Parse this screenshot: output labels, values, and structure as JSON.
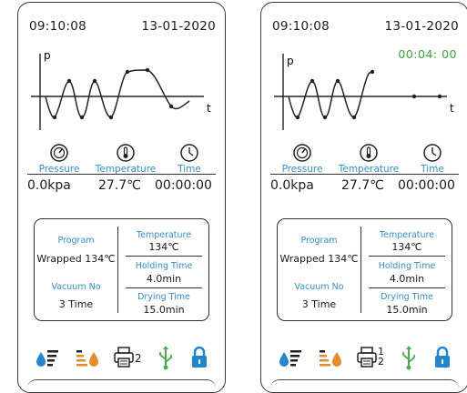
{
  "screens": [
    {
      "header": {
        "time": "09:10:08",
        "date": "13-01-2020"
      },
      "graph": {
        "y_label": "p",
        "x_label": "t"
      },
      "sensors": [
        {
          "label": "Pressure",
          "icon": "pressure-gauge-icon",
          "value": "0.0kpa"
        },
        {
          "label": "Temperature",
          "icon": "thermometer-icon",
          "value": "27.7℃"
        },
        {
          "label": "Time",
          "icon": "clock-icon",
          "value": "00:00:00"
        }
      ],
      "program": {
        "program_label": "Program",
        "program_value": "Wrapped 134℃",
        "vacuum_label": "Vacuum No",
        "vacuum_value": "3 Time",
        "temperature_label": "Temperature",
        "temperature_value": "134℃",
        "holding_label": "Holding Time",
        "holding_value": "4.0min",
        "drying_label": "Drying Time",
        "drying_value": "15.0min"
      },
      "status_icons": {
        "printer_count": "2"
      }
    },
    {
      "header": {
        "time": "09:10:08",
        "date": "13-01-2020",
        "timer": "00:04: 00"
      },
      "graph": {
        "y_label": "p",
        "x_label": "t"
      },
      "sensors": [
        {
          "label": "Pressure",
          "icon": "pressure-gauge-icon",
          "value": "0.0kpa"
        },
        {
          "label": "Temperature",
          "icon": "thermometer-icon",
          "value": "27.7℃"
        },
        {
          "label": "Time",
          "icon": "clock-icon",
          "value": "00:00:00"
        }
      ],
      "program": {
        "program_label": "Program",
        "program_value": "Wrapped 134℃",
        "vacuum_label": "Vacuum No",
        "vacuum_value": "3 Time",
        "temperature_label": "Temperature",
        "temperature_value": "134℃",
        "holding_label": "Holding Time",
        "holding_value": "4.0min",
        "drying_label": "Drying Time",
        "drying_value": "15.0min"
      },
      "status_icons": {
        "printer_count": "1 2"
      }
    }
  ],
  "colors": {
    "label_blue": "#2f8fd3",
    "timer_green": "#3aa63a",
    "icon_blue": "#1f86d1",
    "icon_orange": "#e8892a",
    "icon_green": "#44b04a"
  }
}
